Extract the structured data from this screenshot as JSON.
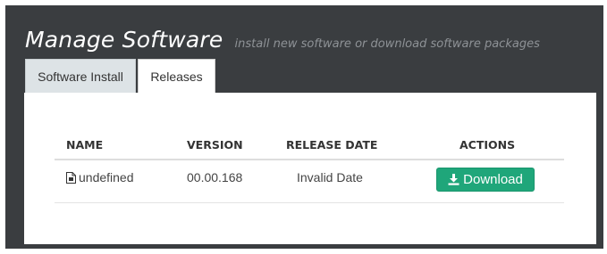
{
  "header": {
    "title": "Manage Software",
    "subtitle": "install new software or download software packages"
  },
  "tabs": [
    {
      "label": "Software Install",
      "active": false
    },
    {
      "label": "Releases",
      "active": true
    }
  ],
  "table": {
    "columns": [
      "NAME",
      "VERSION",
      "RELEASE DATE",
      "ACTIONS"
    ],
    "rows": [
      {
        "name": "undefined",
        "version": "00.00.168",
        "release_date": "Invalid Date",
        "action_label": "Download"
      }
    ]
  },
  "icons": {
    "file": "file-icon",
    "download": "download-icon"
  },
  "colors": {
    "background": "#3a3d40",
    "accent": "#1fa67a"
  }
}
